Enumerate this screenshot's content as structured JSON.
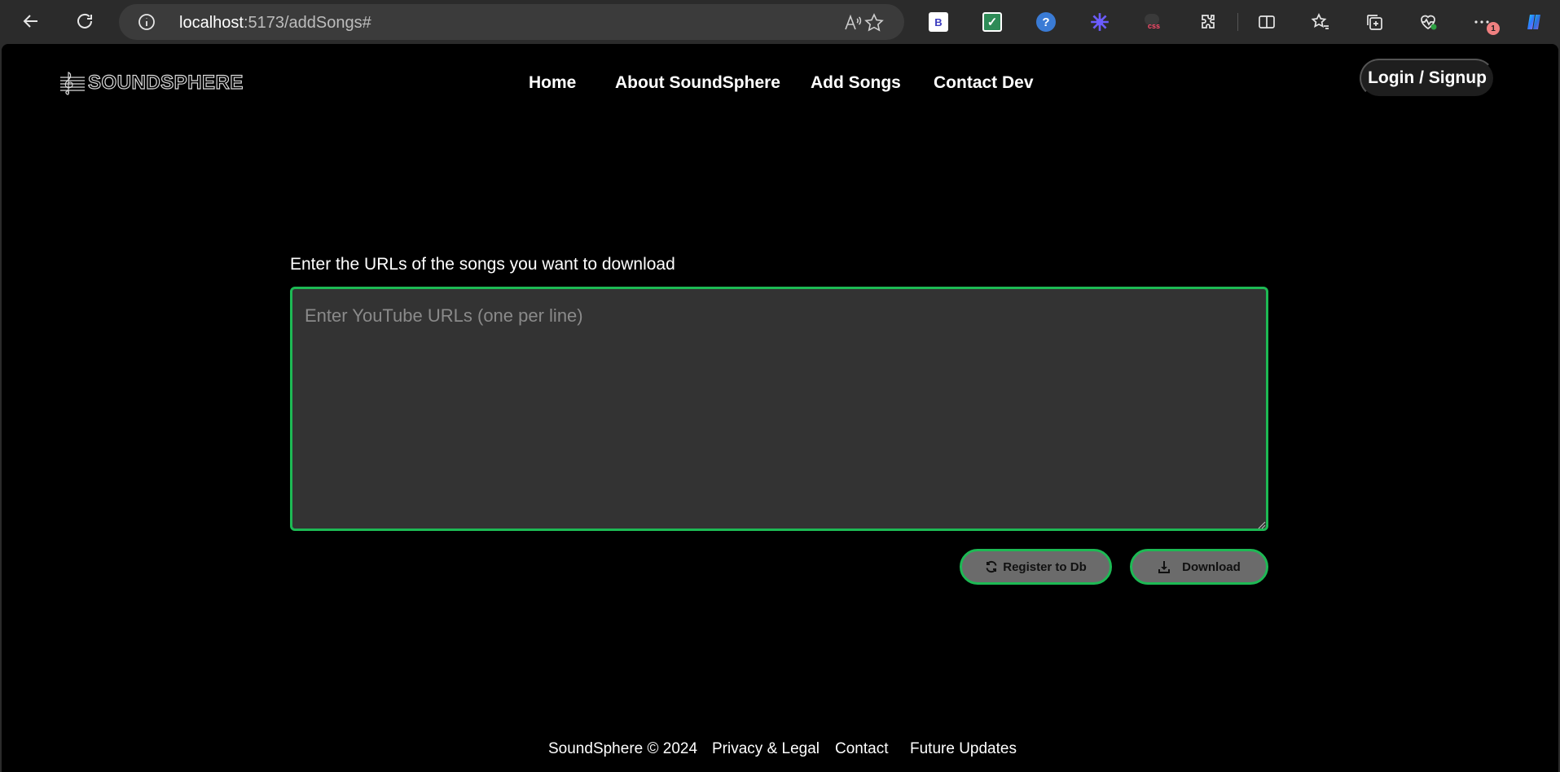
{
  "browser": {
    "url_host": "localhost",
    "url_rest": ":5173/addSongs#",
    "extensions": [
      "bootstrap-ext-icon",
      "todo-check-icon",
      "help-circle-icon",
      "sun-burst-icon",
      "css-ext-icon"
    ],
    "profile_badge": "1"
  },
  "header": {
    "logo_text": "SOUNDSPHERE",
    "nav": [
      "Home",
      "About SoundSphere",
      "Add Songs",
      "Contact Dev"
    ],
    "login_label": "Login / Signup"
  },
  "form": {
    "label": "Enter the URLs of the songs you want to download",
    "placeholder": "Enter YouTube URLs (one per line)",
    "value": "",
    "register_label": "Register to Db",
    "download_label": "Download"
  },
  "footer": {
    "copyright": "SoundSphere © 2024",
    "links": [
      "Privacy & Legal",
      "Contact",
      "Future Updates"
    ]
  },
  "colors": {
    "accent": "#1db954",
    "background": "#000000",
    "input_bg": "#333333"
  }
}
